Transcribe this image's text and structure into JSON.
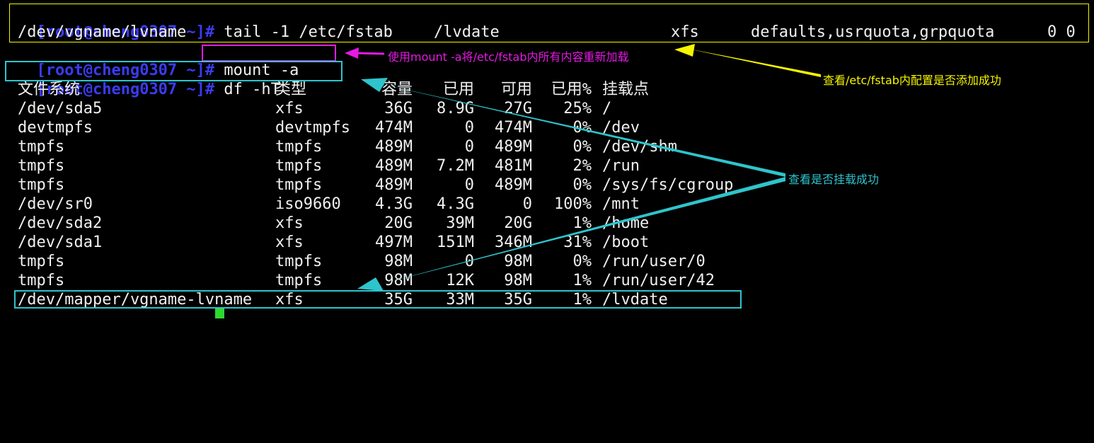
{
  "terminal": {
    "prompt": "[root@cheng0307 ~]#",
    "cmd_tail": " tail -1 /etc/fstab",
    "cmd_mount": " mount -a",
    "cmd_df": " df -hT",
    "fstab_line": {
      "device": "/dev/vgname/lvname",
      "mount_point": "/lvdate",
      "fs_type": "xfs",
      "options": "defaults,usrquota,grpquota",
      "dump_pass": "0 0"
    },
    "df_headers": [
      "文件系统",
      "类型",
      "容量",
      "已用",
      "可用",
      "已用%",
      "挂载点"
    ],
    "df_rows": [
      [
        "/dev/sda5",
        "xfs",
        "36G",
        "8.9G",
        "27G",
        "25%",
        "/"
      ],
      [
        "devtmpfs",
        "devtmpfs",
        "474M",
        "0",
        "474M",
        "0%",
        "/dev"
      ],
      [
        "tmpfs",
        "tmpfs",
        "489M",
        "0",
        "489M",
        "0%",
        "/dev/shm"
      ],
      [
        "tmpfs",
        "tmpfs",
        "489M",
        "7.2M",
        "481M",
        "2%",
        "/run"
      ],
      [
        "tmpfs",
        "tmpfs",
        "489M",
        "0",
        "489M",
        "0%",
        "/sys/fs/cgroup"
      ],
      [
        "/dev/sr0",
        "iso9660",
        "4.3G",
        "4.3G",
        "0",
        "100%",
        "/mnt"
      ],
      [
        "/dev/sda2",
        "xfs",
        "20G",
        "39M",
        "20G",
        "1%",
        "/home"
      ],
      [
        "/dev/sda1",
        "xfs",
        "497M",
        "151M",
        "346M",
        "31%",
        "/boot"
      ],
      [
        "tmpfs",
        "tmpfs",
        "98M",
        "0",
        "98M",
        "0%",
        "/run/user/0"
      ],
      [
        "tmpfs",
        "tmpfs",
        "98M",
        "12K",
        "98M",
        "1%",
        "/run/user/42"
      ],
      [
        "/dev/mapper/vgname-lvname",
        "xfs",
        "35G",
        "33M",
        "35G",
        "1%",
        "/lvdate"
      ]
    ]
  },
  "annotations": {
    "mount_note": "使用mount -a将/etc/fstab内所有内容重新加载",
    "fstab_note": "查看/etc/fstab内配置是否添加成功",
    "df_note": "查看是否挂载成功"
  },
  "colors": {
    "background": "#000000",
    "prompt": "#3b3bf0",
    "text": "#f0f0f0",
    "yellow": "#f5f500",
    "magenta": "#e619e6",
    "cyan": "#2ec4cc",
    "cursor": "#2fd82f"
  }
}
